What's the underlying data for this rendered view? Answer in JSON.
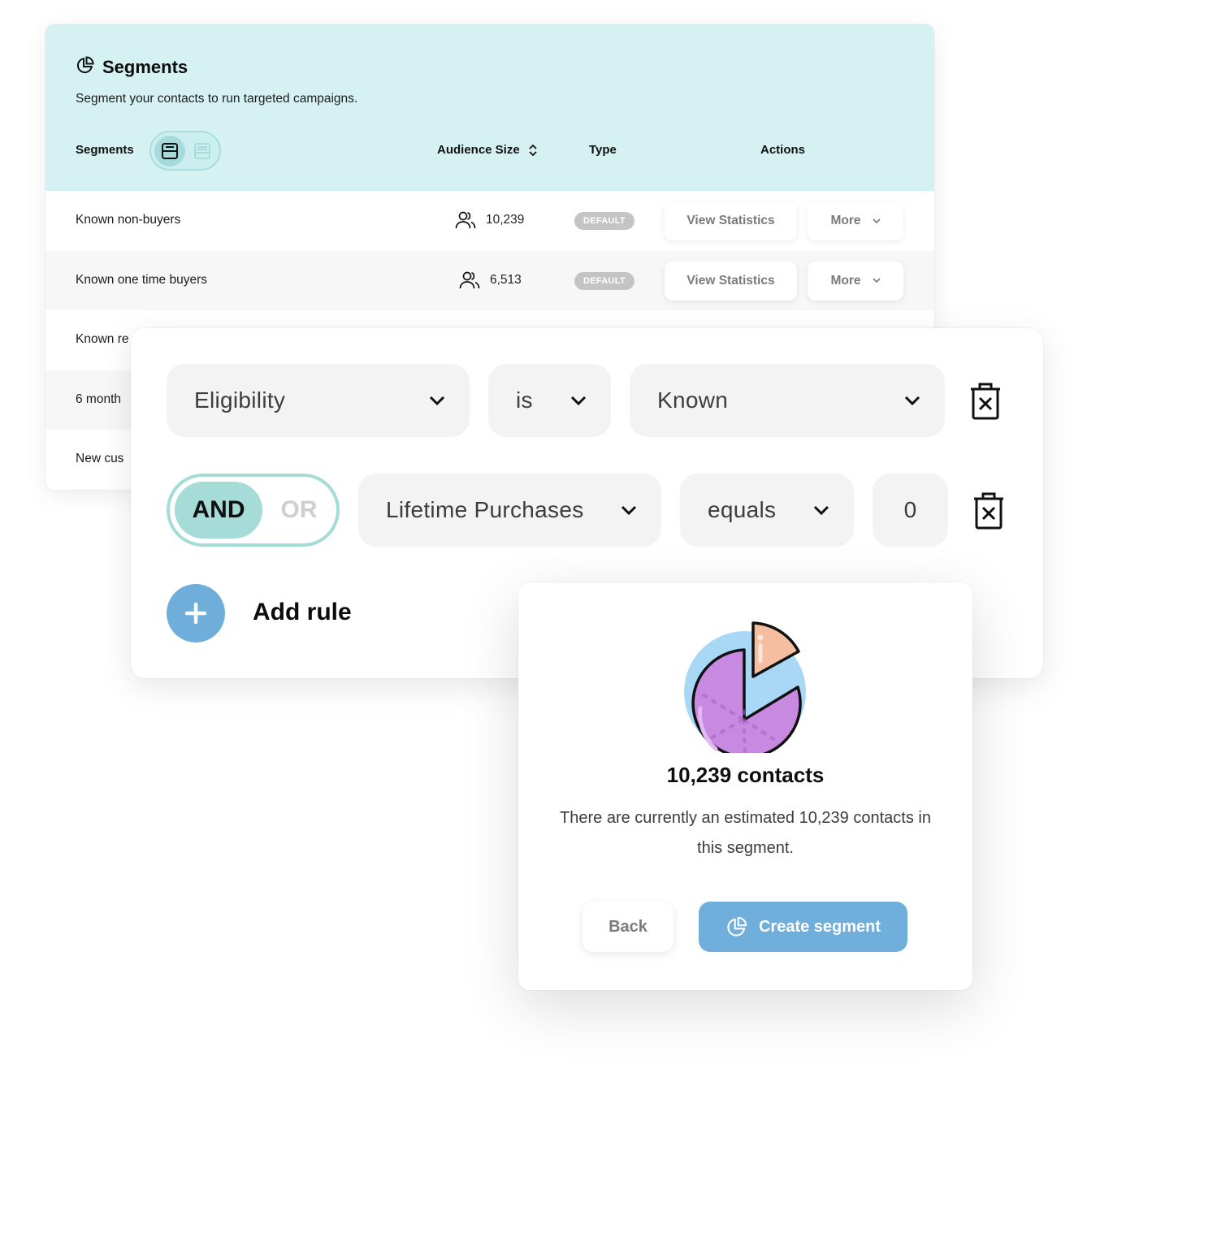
{
  "segments_panel": {
    "title": "Segments",
    "title_icon": "pie-chart-icon",
    "subtitle": "Segment your contacts to run targeted campaigns.",
    "columns": {
      "segments": "Segments",
      "audience_size": "Audience Size",
      "type": "Type",
      "actions": "Actions"
    },
    "view_toggle": {
      "options": [
        "card-view-icon",
        "list-view-icon"
      ],
      "selected": "card-view-icon"
    },
    "rows": [
      {
        "name": "Known non-buyers",
        "audience": "10,239",
        "type": "DEFAULT",
        "view_label": "View Statistics",
        "more_label": "More"
      },
      {
        "name": "Known one time buyers",
        "audience": "6,513",
        "type": "DEFAULT",
        "view_label": "View Statistics",
        "more_label": "More"
      },
      {
        "name": "Known re"
      },
      {
        "name": "6 month"
      },
      {
        "name": "New cus"
      }
    ]
  },
  "rule_builder": {
    "rule1": {
      "field": "Eligibility",
      "operator": "is",
      "value": "Known"
    },
    "conjunction": {
      "options": [
        "AND",
        "OR"
      ],
      "selected": "AND"
    },
    "rule2": {
      "field": "Lifetime Purchases",
      "operator": "equals",
      "value": "0"
    },
    "add_rule_label": "Add rule"
  },
  "estimate": {
    "count_label": "10,239 contacts",
    "description": "There are currently an estimated 10,239 contacts in this segment.",
    "back_label": "Back",
    "create_label": "Create segment",
    "colors": {
      "primary": "#70aedb",
      "pie_main": "#c78ae0",
      "pie_slice": "#f5bea0",
      "pie_ring": "#a9d8f7"
    }
  }
}
